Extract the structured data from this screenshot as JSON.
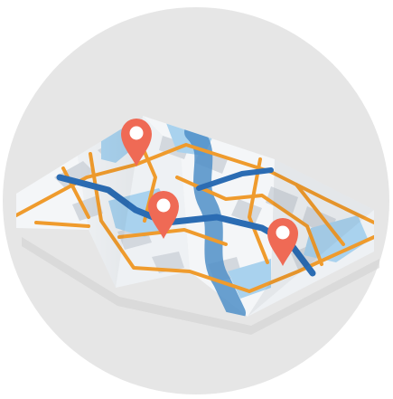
{
  "icon": {
    "name": "folded-map-with-location-pins-icon",
    "pin_count": 3
  },
  "colors": {
    "badge_background": "#e6e6e6",
    "map_panel_light": "#f4f6f8",
    "map_panel_shade": "#e3e7ec",
    "block_gray": "#d3d8de",
    "water_light": "#a9d2ee",
    "water_dark": "#4f8fc8",
    "route_blue": "#2b6cb3",
    "road_orange": "#ef9b2d",
    "pin_red": "#ef6a55",
    "pin_center": "#ffffff"
  }
}
